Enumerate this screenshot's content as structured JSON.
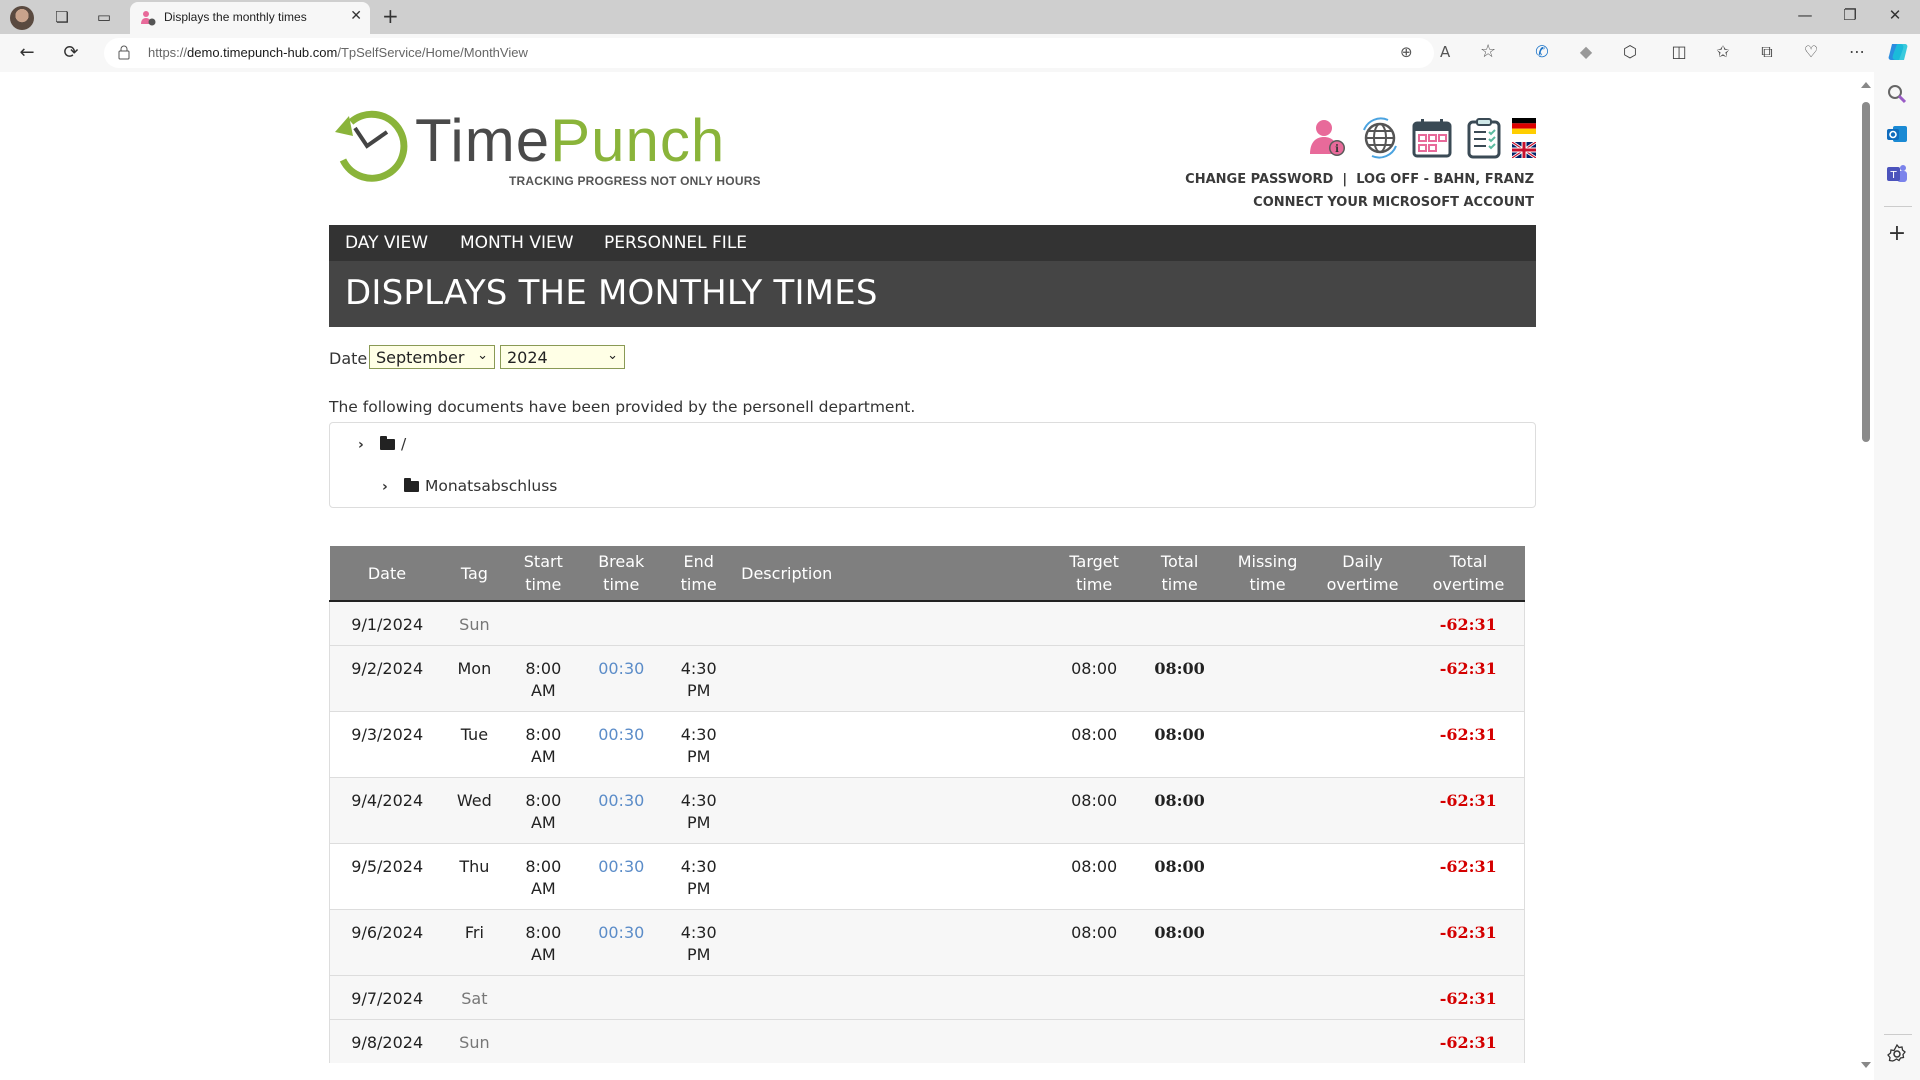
{
  "browser": {
    "tab_title": "Displays the monthly times",
    "url_prefix": "https://",
    "url_domain": "demo.timepunch-hub.com",
    "url_path": "/TpSelfService/Home/MonthView",
    "icons": {
      "back": "←",
      "refresh": "⟳",
      "lock": "🔒",
      "zoom": "⊕",
      "read_aloud": "A",
      "favorite": "☆",
      "phone": "✆",
      "extensions": "⬡",
      "split": "◫",
      "favorites": "✩",
      "collections": "⧉",
      "health": "♡",
      "more": "⋯",
      "minimize": "—",
      "restore": "❐",
      "close": "✕",
      "new_tab": "+",
      "tab_close": "✕"
    }
  },
  "sidebar_icons": [
    "search",
    "outlook",
    "teams",
    "add",
    "settings"
  ],
  "logo": {
    "word_time": "Time",
    "word_punch": "Punch",
    "tagline": "TRACKING PROGRESS NOT ONLY HOURS"
  },
  "header": {
    "change_password": "CHANGE PASSWORD",
    "separator": "|",
    "log_off": "LOG OFF - BAHN, FRANZ",
    "connect_ms": "CONNECT YOUR MICROSOFT ACCOUNT",
    "icons": [
      "user-info",
      "globe",
      "calendar",
      "checklist"
    ],
    "languages": [
      "de",
      "en"
    ]
  },
  "nav": {
    "day_view": "DAY VIEW",
    "month_view": "MONTH VIEW",
    "personnel_file": "PERSONNEL FILE"
  },
  "page_title": "DISPLAYS THE MONTHLY TIMES",
  "date_filter": {
    "label": "Date",
    "month": "September",
    "year": "2024"
  },
  "documents": {
    "intro": "The following documents have been provided by the personell department.",
    "tree": [
      {
        "name": "/"
      },
      {
        "name": "Monatsabschluss"
      }
    ]
  },
  "table": {
    "headers": [
      [
        "Date"
      ],
      [
        "Tag"
      ],
      [
        "Start",
        "time"
      ],
      [
        "Break",
        "time"
      ],
      [
        "End",
        "time"
      ],
      [
        "Description"
      ],
      [
        "Target",
        "time"
      ],
      [
        "Total",
        "time"
      ],
      [
        "Missing",
        "time"
      ],
      [
        "Daily",
        "overtime"
      ],
      [
        "Total",
        "overtime"
      ]
    ],
    "rows": [
      {
        "date": "9/1/2024",
        "tag": "Sun",
        "start": "",
        "start2": "",
        "break": "",
        "end": "",
        "end2": "",
        "desc": "",
        "target": "",
        "total": "",
        "missing": "",
        "daily": "",
        "total_ot": "-62:31",
        "weekend": true
      },
      {
        "date": "9/2/2024",
        "tag": "Mon",
        "start": "8:00",
        "start2": "AM",
        "break": "00:30",
        "end": "4:30",
        "end2": "PM",
        "desc": "",
        "target": "08:00",
        "total": "08:00",
        "missing": "",
        "daily": "",
        "total_ot": "-62:31",
        "weekend": false
      },
      {
        "date": "9/3/2024",
        "tag": "Tue",
        "start": "8:00",
        "start2": "AM",
        "break": "00:30",
        "end": "4:30",
        "end2": "PM",
        "desc": "",
        "target": "08:00",
        "total": "08:00",
        "missing": "",
        "daily": "",
        "total_ot": "-62:31",
        "weekend": false
      },
      {
        "date": "9/4/2024",
        "tag": "Wed",
        "start": "8:00",
        "start2": "AM",
        "break": "00:30",
        "end": "4:30",
        "end2": "PM",
        "desc": "",
        "target": "08:00",
        "total": "08:00",
        "missing": "",
        "daily": "",
        "total_ot": "-62:31",
        "weekend": false
      },
      {
        "date": "9/5/2024",
        "tag": "Thu",
        "start": "8:00",
        "start2": "AM",
        "break": "00:30",
        "end": "4:30",
        "end2": "PM",
        "desc": "",
        "target": "08:00",
        "total": "08:00",
        "missing": "",
        "daily": "",
        "total_ot": "-62:31",
        "weekend": false
      },
      {
        "date": "9/6/2024",
        "tag": "Fri",
        "start": "8:00",
        "start2": "AM",
        "break": "00:30",
        "end": "4:30",
        "end2": "PM",
        "desc": "",
        "target": "08:00",
        "total": "08:00",
        "missing": "",
        "daily": "",
        "total_ot": "-62:31",
        "weekend": false
      },
      {
        "date": "9/7/2024",
        "tag": "Sat",
        "start": "",
        "start2": "",
        "break": "",
        "end": "",
        "end2": "",
        "desc": "",
        "target": "",
        "total": "",
        "missing": "",
        "daily": "",
        "total_ot": "-62:31",
        "weekend": true
      },
      {
        "date": "9/8/2024",
        "tag": "Sun",
        "start": "",
        "start2": "",
        "break": "",
        "end": "",
        "end2": "",
        "desc": "",
        "target": "",
        "total": "",
        "missing": "",
        "daily": "",
        "total_ot": "-62:31",
        "weekend": true
      }
    ]
  },
  "colors": {
    "brand_green": "#8ab43a",
    "brand_gray": "#4a4a4a",
    "negative": "#d40000",
    "break_link": "#5b8cc8",
    "nav_bg": "#333333",
    "title_bg": "#454545",
    "table_header_bg": "#7f7f7f",
    "select_bg": "#ffffe6"
  }
}
